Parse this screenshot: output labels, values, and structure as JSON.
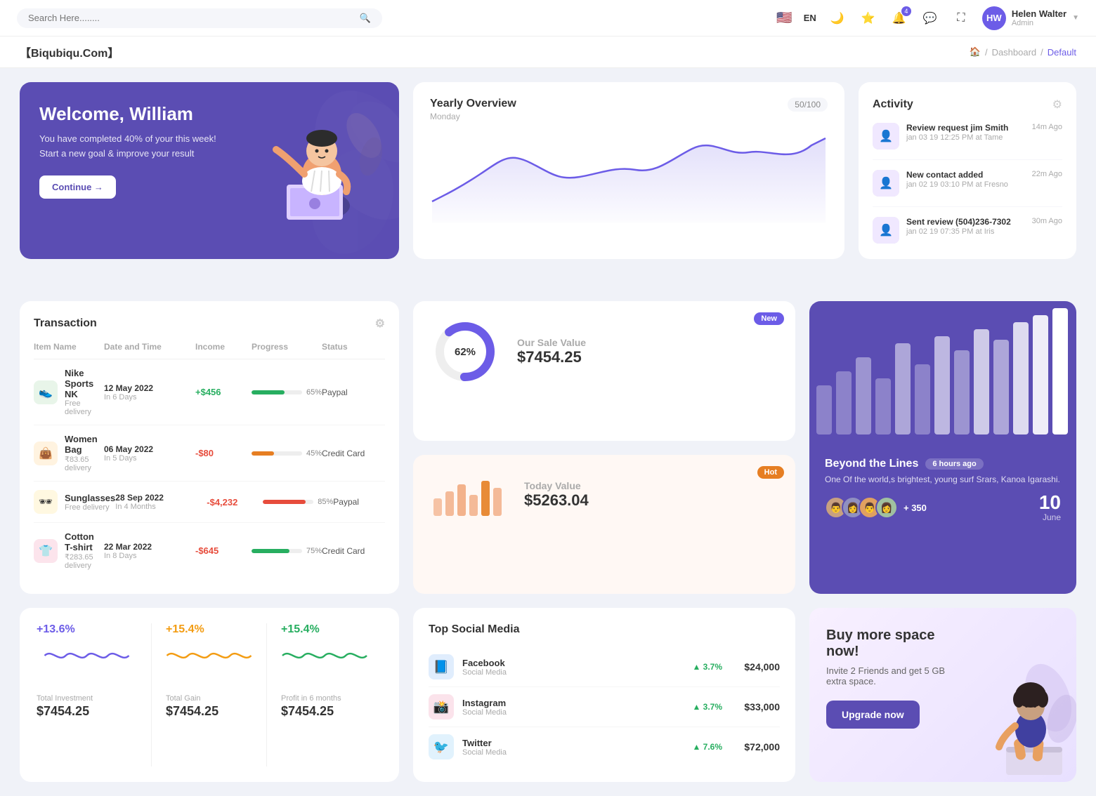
{
  "topnav": {
    "search_placeholder": "Search Here........",
    "lang": "EN",
    "username": "Helen Walter",
    "user_role": "Admin",
    "notification_count": "4"
  },
  "breadcrumb": {
    "brand": "【Biqubiqu.Com】",
    "home": "⌂",
    "separator": "/",
    "dashboard": "Dashboard",
    "current": "Default"
  },
  "welcome": {
    "title": "Welcome, William",
    "description": "You have completed 40% of your this week! Start a new goal & improve your result",
    "button": "Continue →"
  },
  "yearly_overview": {
    "title": "Yearly Overview",
    "subtitle": "Monday",
    "progress": "50/100"
  },
  "activity": {
    "title": "Activity",
    "items": [
      {
        "title": "Review request jim Smith",
        "detail": "jan 03 19 12:25 PM at Tame",
        "time": "14m Ago"
      },
      {
        "title": "New contact added",
        "detail": "jan 02 19 03:10 PM at Fresno",
        "time": "22m Ago"
      },
      {
        "title": "Sent review (504)236-7302",
        "detail": "jan 02 19 07:35 PM at Iris",
        "time": "30m Ago"
      }
    ]
  },
  "transaction": {
    "title": "Transaction",
    "headers": [
      "Item Name",
      "Date and Time",
      "Income",
      "Progress",
      "Status"
    ],
    "rows": [
      {
        "name": "Nike Sports NK",
        "sub": "Free delivery",
        "date": "12 May 2022",
        "date_sub": "In 6 Days",
        "income": "+$456",
        "positive": true,
        "progress": 65,
        "progress_color": "#27ae60",
        "status": "Paypal",
        "icon": "👟",
        "icon_bg": "#e8f5e9"
      },
      {
        "name": "Women Bag",
        "sub": "₹83.65 delivery",
        "date": "06 May 2022",
        "date_sub": "In 5 Days",
        "income": "-$80",
        "positive": false,
        "progress": 45,
        "progress_color": "#e67e22",
        "status": "Credit Card",
        "icon": "👜",
        "icon_bg": "#fff3e0"
      },
      {
        "name": "Sunglasses",
        "sub": "Free delivery",
        "date": "28 Sep 2022",
        "date_sub": "In 4 Months",
        "income": "-$4,232",
        "positive": false,
        "progress": 85,
        "progress_color": "#e74c3c",
        "status": "Paypal",
        "icon": "🕶",
        "icon_bg": "#fff8e1"
      },
      {
        "name": "Cotton T-shirt",
        "sub": "₹283.65 delivery",
        "date": "22 Mar 2022",
        "date_sub": "In 8 Days",
        "income": "-$645",
        "positive": false,
        "progress": 75,
        "progress_color": "#27ae60",
        "status": "Credit Card",
        "icon": "👕",
        "icon_bg": "#fce4ec"
      }
    ]
  },
  "sale_value": {
    "badge": "New",
    "donut_pct": "62%",
    "label": "Our Sale Value",
    "value": "$7454.25"
  },
  "today_value": {
    "badge": "Hot",
    "label": "Today Value",
    "value": "$5263.04"
  },
  "beyond": {
    "title": "Beyond the Lines",
    "time_ago": "6 hours ago",
    "description": "One Of the world,s brightest, young surf Srars, Kanoa Igarashi.",
    "plus_count": "+ 350",
    "date_day": "10",
    "date_month": "June"
  },
  "stats": [
    {
      "pct": "+13.6%",
      "label": "Total Investment",
      "value": "$7454.25",
      "color": "#6c5ce7"
    },
    {
      "pct": "+15.4%",
      "label": "Total Gain",
      "value": "$7454.25",
      "color": "#f39c12"
    },
    {
      "pct": "+15.4%",
      "label": "Profit in 6 months",
      "value": "$7454.25",
      "color": "#27ae60"
    }
  ],
  "social_media": {
    "title": "Top Social Media",
    "items": [
      {
        "name": "Facebook",
        "sub": "Social Media",
        "pct": "3.7%",
        "value": "$24,000",
        "icon": "📘",
        "color": "#1877f2"
      },
      {
        "name": "Instagram",
        "sub": "Social Media",
        "pct": "3.7%",
        "value": "$33,000",
        "icon": "📸",
        "color": "#e1306c"
      },
      {
        "name": "Twitter",
        "sub": "Social Media",
        "pct": "7.6%",
        "value": "$72,000",
        "icon": "🐦",
        "color": "#1da1f2"
      }
    ]
  },
  "promo": {
    "title": "Buy more space now!",
    "description": "Invite 2 Friends and get 5 GB extra space.",
    "button": "Upgrade now"
  }
}
